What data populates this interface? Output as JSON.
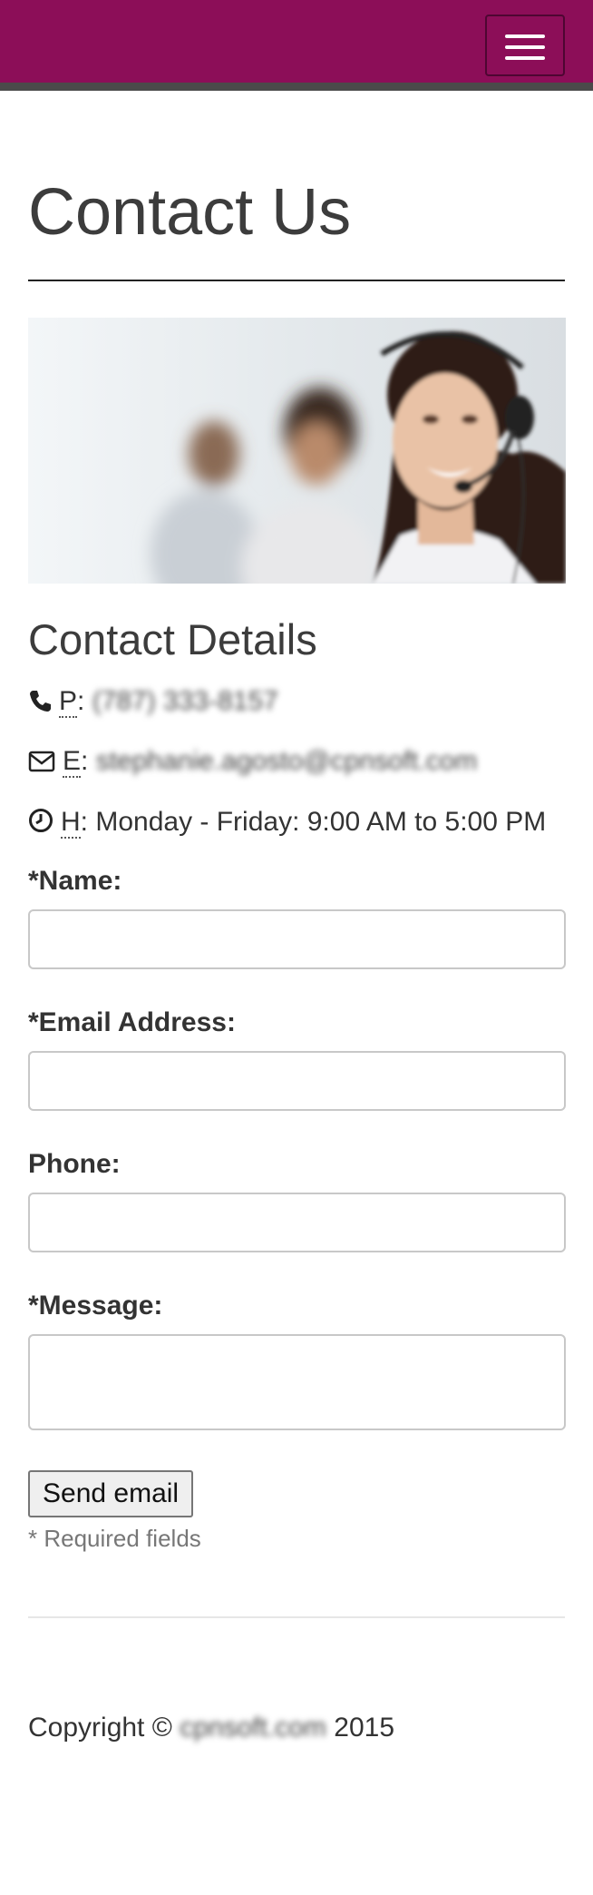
{
  "navbar": {
    "bg_color": "#8c0e58",
    "menu_icon": "hamburger-menu-icon"
  },
  "page": {
    "title": "Contact Us"
  },
  "contact": {
    "heading": "Contact Details",
    "phone_abbr": "P",
    "phone_value": "(787) 333-8157",
    "email_abbr": "E",
    "email_value": "stephanie.agosto@cpnsoft.com",
    "hours_abbr": "H",
    "hours_value": ": Monday - Friday: 9:00 AM to 5:00 PM"
  },
  "form": {
    "name_label": "*Name:",
    "email_label": "*Email Address:",
    "phone_label": "Phone:",
    "message_label": "*Message:",
    "submit_label": "Send email",
    "required_note": "* Required fields"
  },
  "footer": {
    "copyright_prefix": "Copyright ©",
    "company": "cpnsoft.com",
    "year": "2015"
  }
}
